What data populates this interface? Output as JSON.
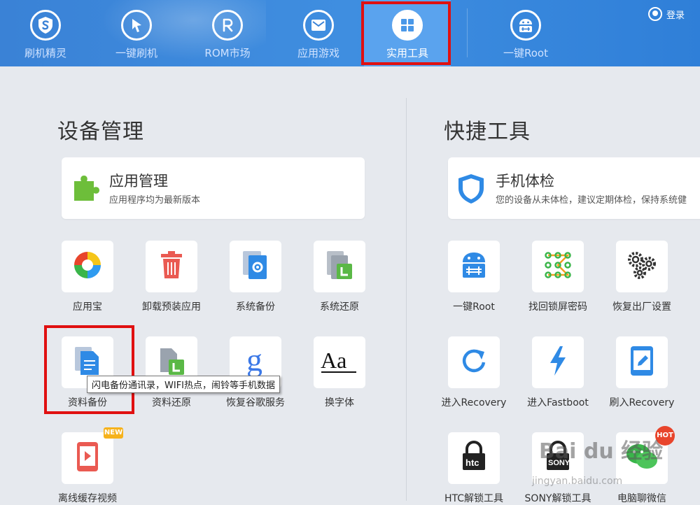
{
  "nav": {
    "tabs": [
      {
        "label": "刷机精灵",
        "icon": "shield-s-icon"
      },
      {
        "label": "一键刷机",
        "icon": "cursor-arrow-icon"
      },
      {
        "label": "ROM市场",
        "icon": "r-letter-icon"
      },
      {
        "label": "应用游戏",
        "icon": "mail-icon"
      },
      {
        "label": "实用工具",
        "icon": "grid-icon",
        "active": true
      },
      {
        "label": "一键Root",
        "icon": "android-root-icon"
      }
    ],
    "login_label": "登录",
    "accent_color": "#3a82d6",
    "active_color": "#5aa3ee",
    "highlight_color": "#e01010"
  },
  "device": {
    "title": "设备管理",
    "card": {
      "title": "应用管理",
      "subtitle": "应用程序均为最新版本",
      "icon": "puzzle-icon"
    },
    "tools": [
      {
        "label": "应用宝",
        "icon": "yingyongbao-icon"
      },
      {
        "label": "卸载预装应用",
        "icon": "trash-icon"
      },
      {
        "label": "系统备份",
        "icon": "system-backup-icon"
      },
      {
        "label": "系统还原",
        "icon": "system-restore-icon"
      },
      {
        "label": "资料备份",
        "icon": "document-backup-icon"
      },
      {
        "label": "资料还原",
        "icon": "document-restore-icon"
      },
      {
        "label": "恢复谷歌服务",
        "icon": "google-g-icon"
      },
      {
        "label": "换字体",
        "icon": "font-aa-icon"
      },
      {
        "label": "离线缓存视频",
        "icon": "video-phone-icon",
        "badge": "NEW"
      }
    ],
    "tooltip": "闪电备份通讯录，WIFI热点，闹铃等手机数据"
  },
  "quick": {
    "title": "快捷工具",
    "card": {
      "title": "手机体检",
      "subtitle": "您的设备从未体检，建议定期体检，保持系统健",
      "icon": "shield-check-icon"
    },
    "tools": [
      {
        "label": "一键Root",
        "icon": "android-root-icon"
      },
      {
        "label": "找回锁屏密码",
        "icon": "pattern-lock-icon"
      },
      {
        "label": "恢复出厂设置",
        "icon": "gears-icon"
      },
      {
        "label": "进入Recovery",
        "icon": "refresh-icon"
      },
      {
        "label": "进入Fastboot",
        "icon": "lightning-icon"
      },
      {
        "label": "刷入Recovery",
        "icon": "tablet-edit-icon"
      },
      {
        "label": "HTC解锁工具",
        "icon": "htc-lock-icon",
        "brand": "htc"
      },
      {
        "label": "SONY解锁工具",
        "icon": "sony-lock-icon",
        "brand": "SONY"
      },
      {
        "label": "电脑聊微信",
        "icon": "wechat-icon",
        "badge": "HOT"
      }
    ]
  },
  "watermark": {
    "text": "Bai du 经验",
    "url": "jingyan.baidu.com"
  }
}
